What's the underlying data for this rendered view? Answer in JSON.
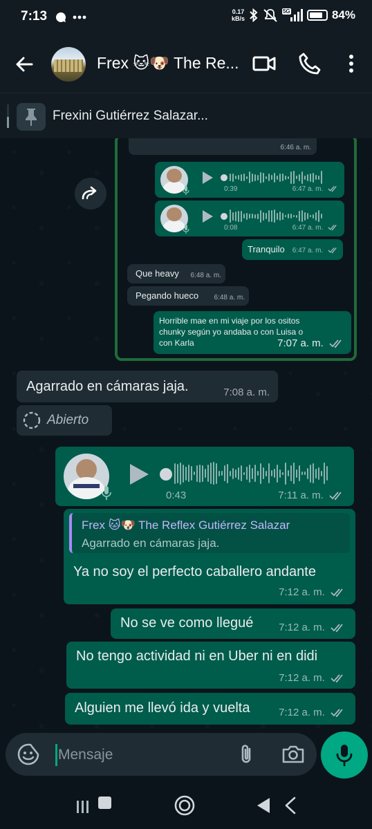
{
  "status": {
    "time": "7:13",
    "net_speed_value": "0.17",
    "net_speed_unit": "kB/s",
    "signal_badge": "5G",
    "battery": "84%",
    "battery_level": 0.84
  },
  "header": {
    "title": "Frex 🐱🐶 The Re...",
    "icons": [
      "back-arrow-icon",
      "video-call-icon",
      "voice-call-icon",
      "more-vert-icon"
    ]
  },
  "pinned": {
    "text": "Frexini Gutiérrez Salazar..."
  },
  "forwarded_screenshot": {
    "messages": [
      {
        "type": "in",
        "text": "",
        "time": "6:46 a. m."
      },
      {
        "type": "out-voice",
        "duration": "0:39",
        "time": "6:47 a. m."
      },
      {
        "type": "out-voice",
        "duration": "0:08",
        "time": "6:47 a. m."
      },
      {
        "type": "out",
        "text": "Tranquilo",
        "time": "6:47 a. m."
      },
      {
        "type": "in",
        "text": "Que heavy",
        "time": "6:48 a. m."
      },
      {
        "type": "in",
        "text": "Pegando hueco",
        "time": "6:48 a. m."
      },
      {
        "type": "out",
        "text_lines": [
          "Horrible mae en mi viaje por los ositos",
          "chunky según yo andaba o con Luisa o",
          "con Karla"
        ],
        "time": "7:07 a. m."
      }
    ]
  },
  "messages": {
    "incoming_caption": {
      "text": "Agarrado en cámaras jaja.",
      "time": "7:08 a. m."
    },
    "view_once": {
      "label": "Abierto"
    },
    "voice_note": {
      "duration": "0:43",
      "time": "7:11 a. m."
    },
    "reply": {
      "quote_author": "Frex 🐱🐶 The Reflex Gutiérrez Salazar",
      "quote_text": "Agarrado en cámaras jaja.",
      "text": "Ya no soy el perfecto caballero andante",
      "time": "7:12 a. m."
    },
    "m1": {
      "text": "No se ve como llegué",
      "time": "7:12 a. m."
    },
    "m2": {
      "text": "No tengo actividad ni en Uber ni en didi",
      "time": "7:12 a. m."
    },
    "m3": {
      "text": "Alguien me llevó ida y vuelta",
      "time": "7:12 a. m."
    }
  },
  "input": {
    "placeholder": "Mensaje"
  },
  "colors": {
    "background": "#0b141a",
    "incoming_bubble": "#202c33",
    "outgoing_bubble": "#005c4b",
    "accent": "#00a884",
    "quote_bar": "#a78bfa",
    "screenshot_border": "#1f6b3a"
  }
}
